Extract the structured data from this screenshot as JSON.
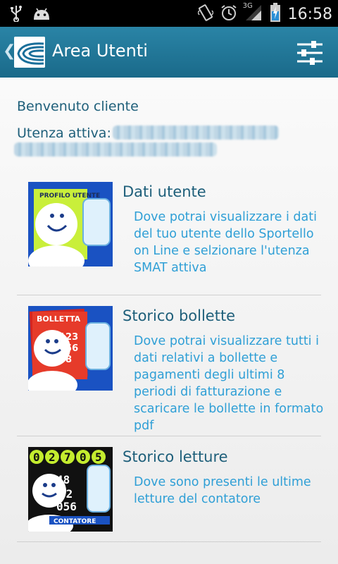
{
  "status_bar": {
    "time": "16:58",
    "network": "3G",
    "icons": [
      "usb-icon",
      "android-icon",
      "vibrate-icon",
      "alarm-icon",
      "signal-icon",
      "battery-charging-icon"
    ]
  },
  "action_bar": {
    "title": "Area Utenti",
    "icons": [
      "back-chevron-icon",
      "app-logo-icon",
      "settings-sliders-icon"
    ]
  },
  "content": {
    "welcome": "Benvenuto cliente",
    "utenza_label": "Utenza attiva:",
    "items": [
      {
        "thumb_label": "PROFILO UTENTE",
        "title": "Dati utente",
        "description": "Dove potrai visualizzare i dati del tuo utente dello Sportello on Line e selzionare l'utenza SMAT attiva"
      },
      {
        "thumb_label": "BOLLETTA",
        "thumb_numbers": "1234 5678",
        "title": "Storico bollette",
        "description": "Dove potrai visualizzare tutti i dati relativi a bollette e pagamenti degli ultimi 8 periodi di fatturazione e scaricare le bollette in formato pdf"
      },
      {
        "thumb_label": "CONTATORE",
        "thumb_digits": "02705",
        "title": "Storico letture",
        "description": "Dove sono presenti le ultime letture del contatore"
      }
    ]
  },
  "colors": {
    "action_bar": "#1f7597",
    "title_text": "#1e5f7a",
    "link_text": "#2f9fd6",
    "background": "#f2f2f2"
  }
}
